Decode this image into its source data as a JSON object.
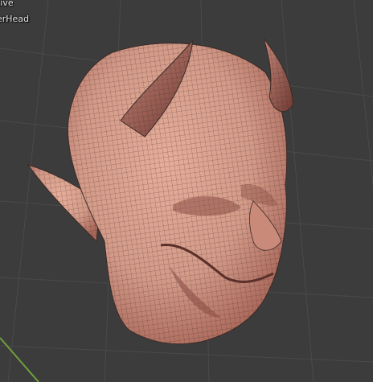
{
  "viewport": {
    "mode_text": "tive",
    "object_text": "erHead",
    "grid_color": "#4a4a4a",
    "background_color": "#3c3c3c",
    "axis_color": "#6fa03c"
  },
  "model": {
    "skin_color": "#d39a88",
    "shadow_color": "#8a4f45",
    "wire_color": "#3a2a26"
  }
}
